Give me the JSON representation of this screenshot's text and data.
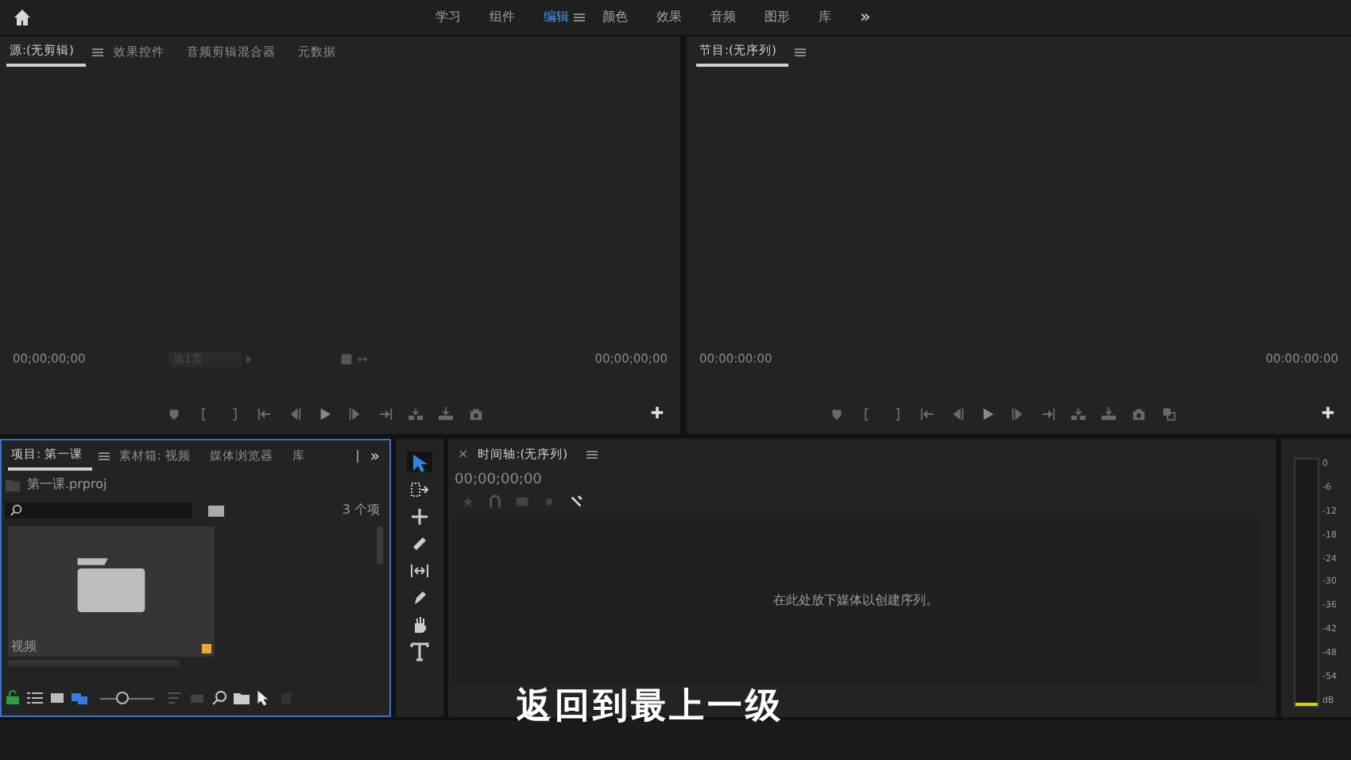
{
  "workspace_tabs": [
    {
      "label": "学习",
      "selected": false
    },
    {
      "label": "组件",
      "selected": false
    },
    {
      "label": "编辑",
      "selected": true
    },
    {
      "label": "颜色",
      "selected": false
    },
    {
      "label": "效果",
      "selected": false
    },
    {
      "label": "音频",
      "selected": false
    },
    {
      "label": "图形",
      "selected": false
    },
    {
      "label": "库",
      "selected": false
    }
  ],
  "workspace_overflow": "»",
  "source_panel": {
    "tabs": [
      {
        "label": "源:(无剪辑)",
        "selected": true
      },
      {
        "label": "效果控件",
        "selected": false
      },
      {
        "label": "音频剪辑混合器",
        "selected": false
      },
      {
        "label": "元数据",
        "selected": false
      }
    ],
    "timecode_left": "00;00;00;00",
    "page_select": "第1页",
    "timecode_right": "00;00;00;00"
  },
  "program_panel": {
    "tabs": [
      {
        "label": "节目:(无序列)",
        "selected": true
      }
    ],
    "timecode_left": "00:00:00:00",
    "timecode_right": "00:00:00:00"
  },
  "project_panel": {
    "tabs": [
      {
        "label": "项目: 第一课",
        "selected": true
      },
      {
        "label": "素材箱: 视频",
        "selected": false
      },
      {
        "label": "媒体浏览器",
        "selected": false
      },
      {
        "label": "库",
        "selected": false
      }
    ],
    "overflow": "»",
    "project_file": "第一课.prproj",
    "item_count": "3 个项",
    "bins": [
      {
        "label": "视频",
        "color": "#e8a93a"
      }
    ],
    "zoom_slider": {
      "level": 0.4
    }
  },
  "tools": [
    {
      "selected": true
    },
    {
      "selected": false
    },
    {
      "selected": false
    },
    {
      "selected": false
    },
    {
      "selected": false
    },
    {
      "selected": false
    },
    {
      "selected": false
    },
    {
      "selected": false
    }
  ],
  "timeline": {
    "close": "×",
    "title": "时间轴:(无序列)",
    "timecode": "00;00;00;00",
    "empty_hint": "在此处放下媒体以创建序列。"
  },
  "audio_meter": {
    "scale": [
      "0",
      "-6",
      "-12",
      "-18",
      "-24",
      "-30",
      "-36",
      "-42",
      "-48",
      "-54",
      "dB"
    ]
  },
  "subtitle": "返回到最上一级"
}
